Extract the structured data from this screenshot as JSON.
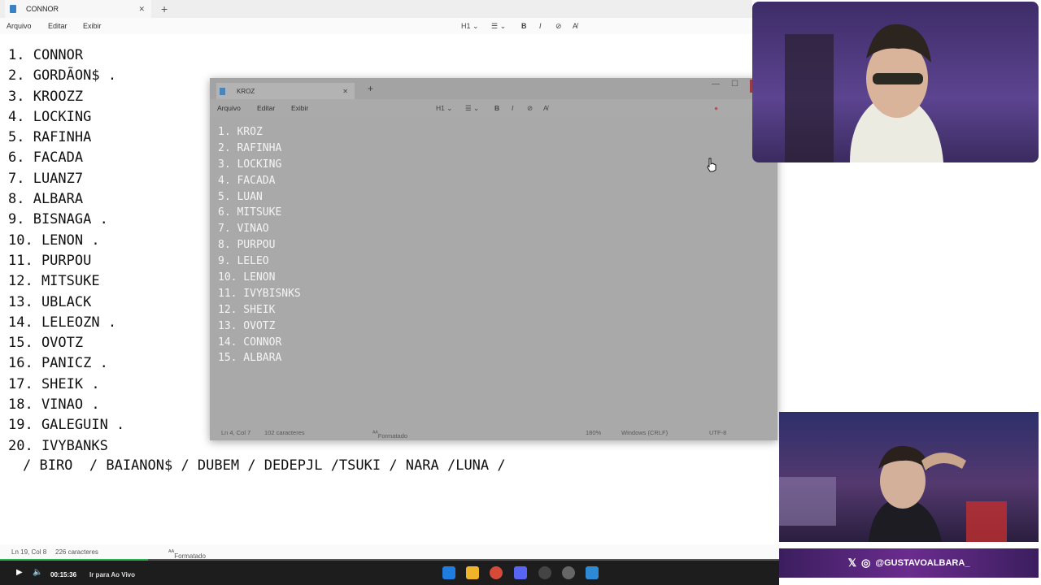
{
  "main_window": {
    "tab_title": "CONNOR",
    "menu": [
      "Arquivo",
      "Editar",
      "Exibir"
    ],
    "toolbar": {
      "heading": "H1",
      "bold": "B",
      "italic": "I"
    },
    "lines": [
      "1. CONNOR",
      "2. GORDÃON$ .",
      "3. KROOZZ",
      "4. LOCKING",
      "5. RAFINHA",
      "6. FACADA",
      "7. LUANZ7",
      "8. ALBARA",
      "9. BISNAGA .",
      "10. LENON .",
      "11. PURPOU",
      "12. MITSUKE",
      "13. UBLACK",
      "14. LELEOZN .",
      "15. OVOTZ",
      "16. PANICZ .",
      "17. SHEIK .",
      "18. VINAO .",
      "19. GALEGUIN .",
      "20. IVYBANKS"
    ],
    "extra_line": "/ BIRO  / BAIANON$ / DUBEM / DEDEPJL /TSUKI / NARA /LUNA /",
    "status": {
      "position": "Ln 19, Col 8",
      "chars": "226 caracteres",
      "format": "Formatado"
    }
  },
  "kroz_window": {
    "tab_title": "KROZ",
    "menu": [
      "Arquivo",
      "Editar",
      "Exibir"
    ],
    "toolbar": {
      "heading": "H1",
      "bold": "B",
      "italic": "I"
    },
    "lines": [
      "1. KROZ",
      "2. RAFINHA",
      "3. LOCKING",
      "4. FACADA",
      "5. LUAN",
      "6. MITSUKE",
      "7. VINAO",
      "8. PURPOU",
      "9. LELEO",
      "10. LENON",
      "11. IVYBISNKS",
      "12. SHEIK",
      "13. OVOTZ",
      "14. CONNOR",
      "15. ALBARA"
    ],
    "status": {
      "position": "Ln 4, Col 7",
      "chars": "102 caracteres",
      "format": "Formatado",
      "zoom": "180%",
      "line_ending": "Windows (CRLF)",
      "encoding": "UTF-8"
    }
  },
  "stream": {
    "handle": "@GUSTAVOALBARA_",
    "time": "00:15:36",
    "live_label": "Ir para Ao Vivo",
    "progress": 0.19
  },
  "colors": {
    "accent": "#29b34d",
    "handle_bg": "#6a2c8e"
  }
}
